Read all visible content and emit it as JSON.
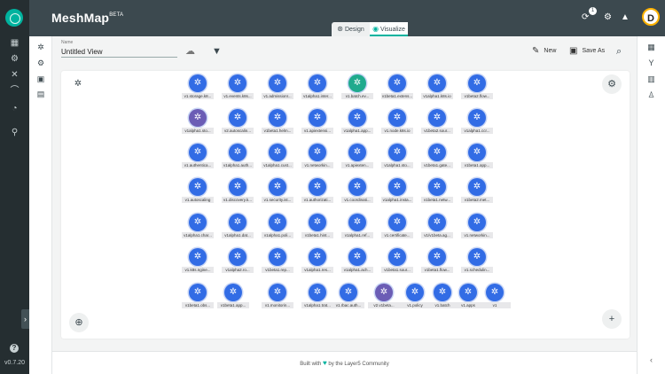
{
  "app": {
    "brand": "MeshMap",
    "brand_sup": "BETA",
    "version": "v0.7.20"
  },
  "modes": {
    "design": "Design",
    "visualize": "Visualize",
    "active": "Visualize"
  },
  "notifications": {
    "count": "1"
  },
  "user": {
    "initial": "D"
  },
  "design": {
    "name_label": "Name",
    "name_value": "Untitled View"
  },
  "toolbar": {
    "new_label": "New",
    "save_as_label": "Save As"
  },
  "footer": {
    "prefix": "Built with",
    "suffix": "by the Layer5 Community"
  },
  "icons": {
    "rail": [
      "dashboard-icon",
      "settings-cog-icon",
      "tools-icon",
      "lifecycle-icon",
      "performance-icon",
      "pin-icon"
    ],
    "palette": [
      "kubernetes-icon",
      "cog-icon",
      "bundle-icon",
      "image-icon"
    ],
    "right_rail": [
      "grid-icon",
      "fork-icon",
      "chart-icon",
      "accessibility-icon"
    ]
  },
  "colors": {
    "accent": "#00b39f",
    "topbar": "#3c494f",
    "rail": "#252e31",
    "node": "#326ce5"
  },
  "nodes": [
    [
      "v1.storage.k8...",
      "v1.events.k8s...",
      "v1.admissionr...",
      "v1alpha1.inter...",
      "v1.batch.ev...",
      "v1beta1.extens...",
      "v1alpha1.k8s.io",
      "v1beta2.flow..."
    ],
    [
      "v1alpha1.sto...",
      "v2.autoscalin...",
      "v1beta1.helm...",
      "v1.apiextensi...",
      "v1alpha1.app...",
      "v1.node.k8s.io",
      "v1beta2.sour...",
      "v1alpha1.ccr..."
    ],
    [
      "v1.authentica...",
      "v1alpha1.auth...",
      "v1alpha1.cust...",
      "v1.networkin...",
      "v1.apiexten...",
      "v1alpha1.sto...",
      "v1beta1.gate...",
      "v1beta1.app..."
    ],
    [
      "v1.autoscaling",
      "v1.discovery.k...",
      "v1.security.ist...",
      "v1.authorizati...",
      "v1.coordinati...",
      "v1alpha1.insta...",
      "v1beta1.netw...",
      "v1beta2.met..."
    ],
    [
      "v1alpha1.char...",
      "v1alpha1.dat...",
      "v1alpha1.poli...",
      "v1beta1.hint...",
      "v1alpha1.ref...",
      "v1.certificate...",
      "v1/v1beta.ag...",
      "v1.networkin..."
    ],
    [
      "v1.k8s.ngine...",
      "v1alpha2.ro...",
      "v1beta1.rep...",
      "v1alpha1.res...",
      "v1alpha1.ach...",
      "v1beta1.sour...",
      "v1beta1.flow...",
      "v1.schedulin..."
    ],
    [
      "v1beta1.obs...",
      "v1beta1.app...",
      "v1.monitorin...",
      "v1alpha1.trat...",
      "v1.rbac.auth...",
      "v2.v1beta...",
      "v1.policy",
      "v1.batch",
      "v1.apps",
      "v1"
    ]
  ]
}
